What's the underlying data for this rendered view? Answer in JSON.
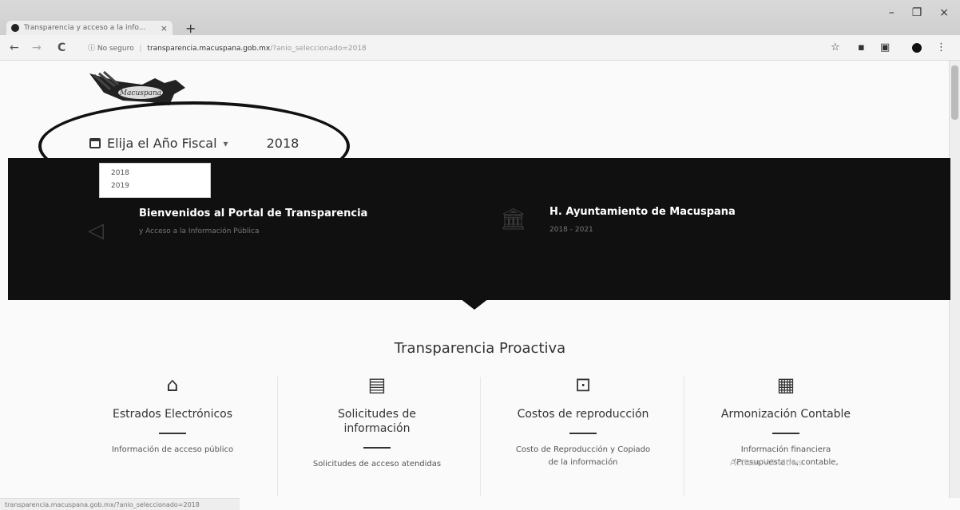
{
  "browser": {
    "tab_title": "Transparencia y acceso a la info...",
    "tab_close": "×",
    "new_tab": "+",
    "window": {
      "minimize": "–",
      "maximize": "❐",
      "close": "×"
    },
    "nav": {
      "back": "←",
      "forward": "→",
      "reload": "C"
    },
    "security_label": "ⓘ No seguro",
    "url_host": "transparencia.macuspana.gob.mx",
    "url_path": "/?anio_seleccionado=2018",
    "status_url": "transparencia.macuspana.gob.mx/?anio_seleccionado=2018"
  },
  "logo": {
    "text": "Macuspana"
  },
  "fiscal": {
    "label": "Elija el Año Fiscal",
    "caret": "▾",
    "value": "2018",
    "options": [
      "2018",
      "2019"
    ]
  },
  "hero": {
    "left": {
      "title": "Bienvenidos al Portal de Transparencia",
      "subtitle": "y Acceso a la Información Pública"
    },
    "right": {
      "title": "H. Ayuntamiento de Macuspana",
      "subtitle": "2018 - 2021"
    }
  },
  "section_title": "Transparencia Proactiva",
  "cards": [
    {
      "title": "Estrados Electrónicos",
      "desc": "Información de acceso público"
    },
    {
      "title": "Solicitudes de información",
      "desc": "Solicitudes de acceso atendidas"
    },
    {
      "title": "Costos de reproducción",
      "desc": "Costo de Reproducción y Copiado de la información"
    },
    {
      "title": "Armonización Contable",
      "desc": "Información financiera (Presupuestaria, contable,"
    }
  ],
  "watermark": "Activar Windows",
  "colors": {
    "hero_bg": "#101010",
    "accent": "#111111"
  }
}
